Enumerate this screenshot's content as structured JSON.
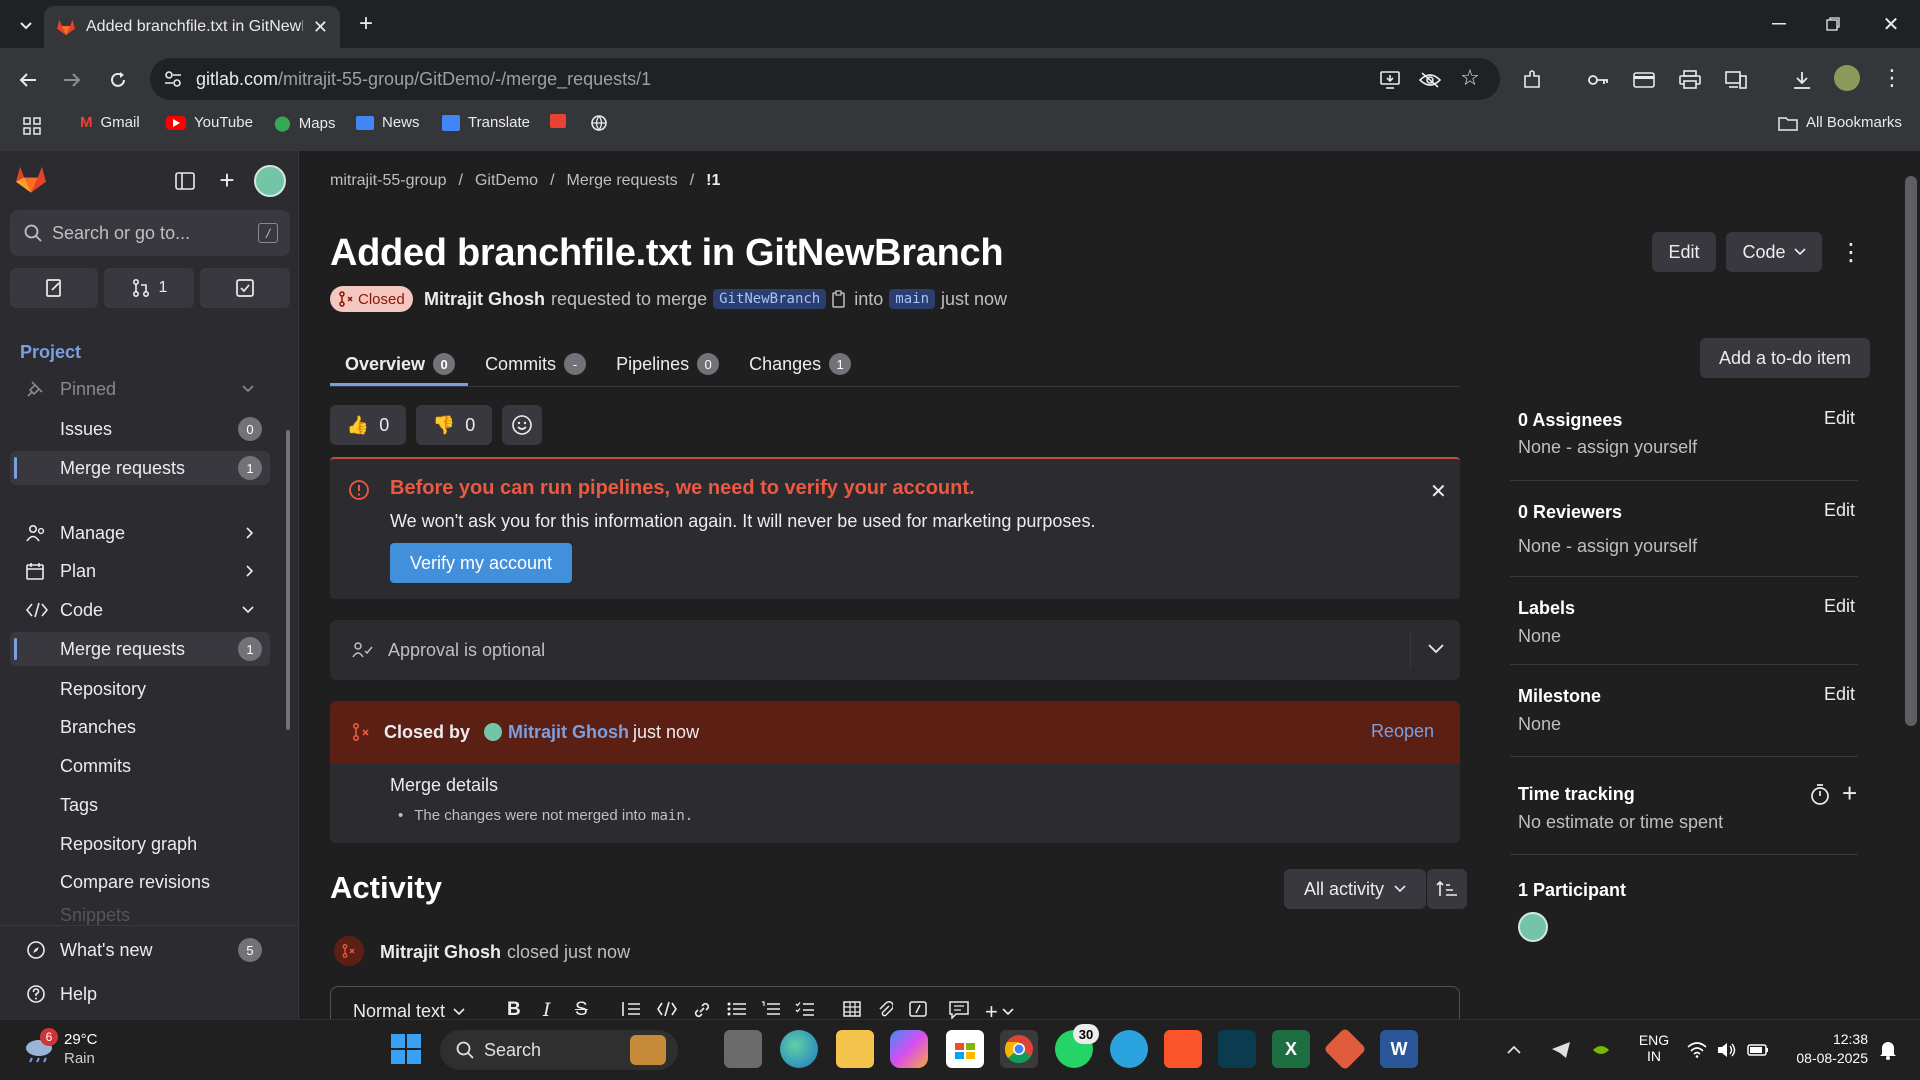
{
  "browser": {
    "tab_title": "Added branchfile.txt in GitNewB",
    "url_host": "gitlab.com",
    "url_path": "/mitrajit-55-group/GitDemo/-/merge_requests/1",
    "bookmarks": [
      "Gmail",
      "YouTube",
      "Maps",
      "News",
      "Translate"
    ],
    "all_bookmarks": "All Bookmarks"
  },
  "sidebar": {
    "search_placeholder": "Search or go to...",
    "search_shortcut": "/",
    "mr_count_pill": "1",
    "section_title": "Project",
    "pinned": "Pinned",
    "pinned_items": [
      {
        "label": "Issues",
        "count": "0"
      },
      {
        "label": "Merge requests",
        "count": "1"
      }
    ],
    "groups": [
      {
        "label": "Manage"
      },
      {
        "label": "Plan"
      },
      {
        "label": "Code"
      }
    ],
    "code_items": [
      {
        "label": "Merge requests",
        "count": "1"
      },
      {
        "label": "Repository"
      },
      {
        "label": "Branches"
      },
      {
        "label": "Commits"
      },
      {
        "label": "Tags"
      },
      {
        "label": "Repository graph"
      },
      {
        "label": "Compare revisions"
      },
      {
        "label": "Snippets"
      }
    ],
    "whats_new": "What's new",
    "whats_new_count": "5",
    "help": "Help"
  },
  "breadcrumb": [
    "mitrajit-55-group",
    "GitDemo",
    "Merge requests",
    "!1"
  ],
  "mr": {
    "title": "Added branchfile.txt in GitNewBranch",
    "status": "Closed",
    "author": "Mitrajit Ghosh",
    "requested_text": "requested to merge",
    "source_branch": "GitNewBranch",
    "into_text": "into",
    "target_branch": "main",
    "time": "just now",
    "edit_label": "Edit",
    "code_label": "Code"
  },
  "tabs": [
    {
      "label": "Overview",
      "count": "0"
    },
    {
      "label": "Commits",
      "count": "-"
    },
    {
      "label": "Pipelines",
      "count": "0"
    },
    {
      "label": "Changes",
      "count": "1"
    }
  ],
  "add_todo": "Add a to-do item",
  "reactions": {
    "thumbs_up": "0",
    "thumbs_down": "0"
  },
  "alert": {
    "title": "Before you can run pipelines, we need to verify your account.",
    "body": "We won't ask you for this information again. It will never be used for marketing purposes.",
    "button": "Verify my account"
  },
  "approval": "Approval is optional",
  "closed": {
    "prefix": "Closed by",
    "user": "Mitrajit Ghosh",
    "time": "just now",
    "reopen": "Reopen",
    "details_title": "Merge details",
    "details_line_prefix": "The changes were not merged into",
    "details_branch": "main."
  },
  "activity": {
    "title": "Activity",
    "filter": "All activity",
    "entry_user": "Mitrajit Ghosh",
    "entry_text": "closed just now",
    "editor_format": "Normal text"
  },
  "right": {
    "assignees_title": "0 Assignees",
    "assignees_val": "None - assign yourself",
    "reviewers_title": "0 Reviewers",
    "reviewers_val": "None - assign yourself",
    "labels_title": "Labels",
    "labels_val": "None",
    "milestone_title": "Milestone",
    "milestone_val": "None",
    "time_title": "Time tracking",
    "time_val": "No estimate or time spent",
    "participants_title": "1 Participant",
    "edit": "Edit"
  },
  "taskbar": {
    "weather_temp": "29°C",
    "weather_text": "Rain",
    "weather_badge": "6",
    "search": "Search",
    "whatsapp_badge": "30",
    "lang1": "ENG",
    "lang2": "IN",
    "time": "12:38",
    "date": "08-08-2025"
  }
}
